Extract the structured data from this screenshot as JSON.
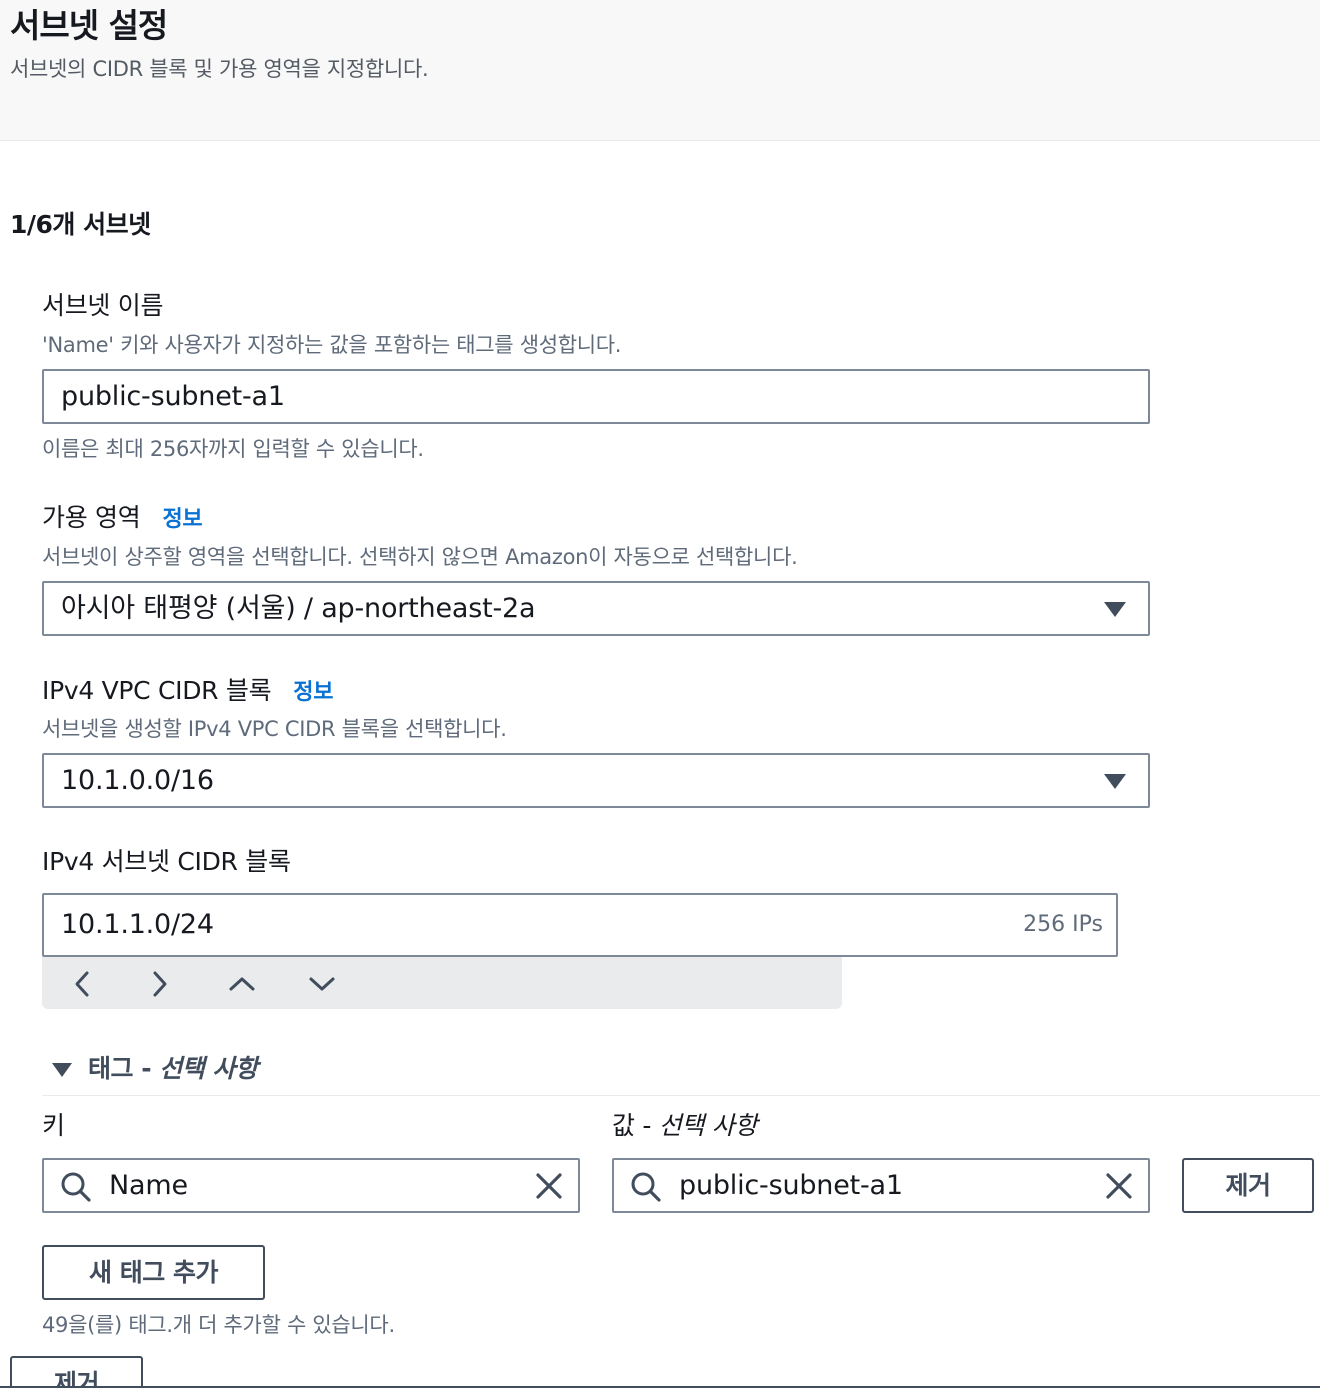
{
  "header": {
    "title": "서브넷 설정",
    "description": "서브넷의 CIDR 블록 및 가용 영역을 지정합니다."
  },
  "section": {
    "title": "1/6개 서브넷"
  },
  "subnet_name": {
    "label": "서브넷 이름",
    "description": "'Name' 키와 사용자가 지정하는 값을 포함하는 태그를 생성합니다.",
    "value": "public-subnet-a1",
    "constraint": "이름은 최대 256자까지 입력할 수 있습니다."
  },
  "availability_zone": {
    "label": "가용 영역",
    "info": "정보",
    "description": "서브넷이 상주할 영역을 선택합니다. 선택하지 않으면 Amazon이 자동으로 선택합니다.",
    "selected": "아시아 태평양 (서울) / ap-northeast-2a"
  },
  "vpc_cidr": {
    "label": "IPv4 VPC CIDR 블록",
    "info": "정보",
    "description": "서브넷을 생성할 IPv4 VPC CIDR 블록을 선택합니다.",
    "selected": "10.1.0.0/16"
  },
  "subnet_cidr": {
    "label": "IPv4 서브넷 CIDR 블록",
    "value": "10.1.1.0/24",
    "ip_count": "256 IPs"
  },
  "tags": {
    "title_prefix": "태그 - ",
    "title_optional": "선택 사항",
    "key_label": "키",
    "value_label_prefix": "값 - ",
    "value_label_optional": "선택 사항",
    "rows": [
      {
        "key": "Name",
        "value": "public-subnet-a1",
        "remove_label": "제거"
      }
    ],
    "add_label": "새 태그 추가",
    "remaining_note": "49을(를) 태그.개 더 추가할 수 있습니다."
  },
  "footer": {
    "remove_subnet_label": "제거"
  },
  "icons": {
    "stepper": [
      "chevron-left-icon",
      "chevron-right-icon",
      "chevron-up-icon",
      "chevron-down-icon"
    ],
    "search": "search-icon",
    "clear": "close-icon",
    "dropdown": "caret-down-icon"
  },
  "colors": {
    "link": "#0972d3",
    "border": "#7d8998",
    "header_bg": "#f8f8f8"
  }
}
